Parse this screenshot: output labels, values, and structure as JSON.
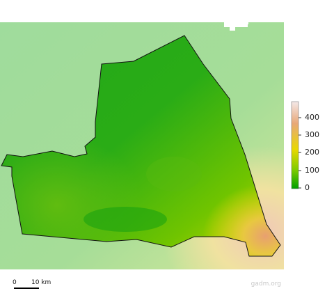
{
  "legend": {
    "ticks": [
      "400",
      "300",
      "200",
      "100",
      "0"
    ],
    "colors": [
      "#f0d8d8",
      "#e8a878",
      "#e8d800",
      "#80cc00",
      "#00a000"
    ]
  },
  "scalebar": {
    "start": "0",
    "end": "10 km"
  },
  "credit": "gadm.org",
  "colors": {
    "background": "#a2dca0",
    "region_low": "#00a000",
    "region_mid": "#80cc00",
    "region_high": "#e8d800",
    "region_peak": "#e8a878",
    "outline": "#111111"
  }
}
